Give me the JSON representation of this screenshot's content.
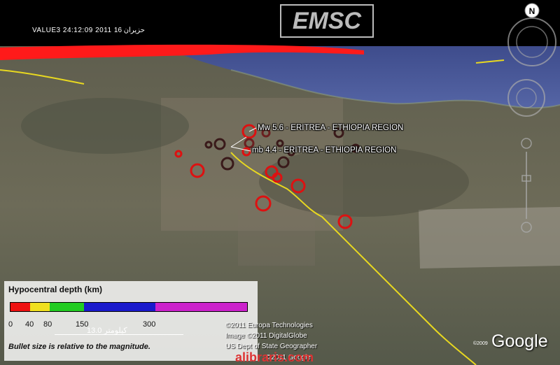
{
  "header": {
    "date_overlay": "VALUE3 24:12:09 2011 حزيران 16",
    "logo": "EMSC"
  },
  "map": {
    "region": "Eritrea - Ethiopia border",
    "colors": {
      "sea": "#4a5a9a",
      "land": "#6b6a5a",
      "border_line": "#e8d820",
      "quake_circle": "#dd1111",
      "horizon_band": "#ff1a1a"
    },
    "events": [
      {
        "label": "Mw 5.6 - ERITREA - ETHIOPIA REGION",
        "magnitude": 5.6,
        "magnitude_type": "Mw"
      },
      {
        "label": "mb 4.4 - ERITREA - ETHIOPIA REGION",
        "magnitude": 4.4,
        "magnitude_type": "mb"
      }
    ]
  },
  "legend": {
    "title": "Hypocentral depth (km)",
    "ticks": [
      "0",
      "40",
      "80",
      "150",
      "300"
    ],
    "colors": [
      "#ee1111",
      "#f0e020",
      "#22cc22",
      "#1a1acc",
      "#cc22cc"
    ],
    "note": "Bullet size is relative to the magnitude."
  },
  "scale": {
    "label": "13.0 كيلومتر"
  },
  "credits": [
    "©2011 Europa Technologies",
    "Image ©2011 DigitalGlobe",
    "US Dept of State Geographer",
    "©2011 Google"
  ],
  "google_logo": "Google",
  "image_date": "©2009",
  "watermark": "alibraris.com",
  "nav_icons": [
    "compass-icon",
    "look-joystick-icon",
    "move-joystick-icon",
    "zoom-slider-icon"
  ]
}
